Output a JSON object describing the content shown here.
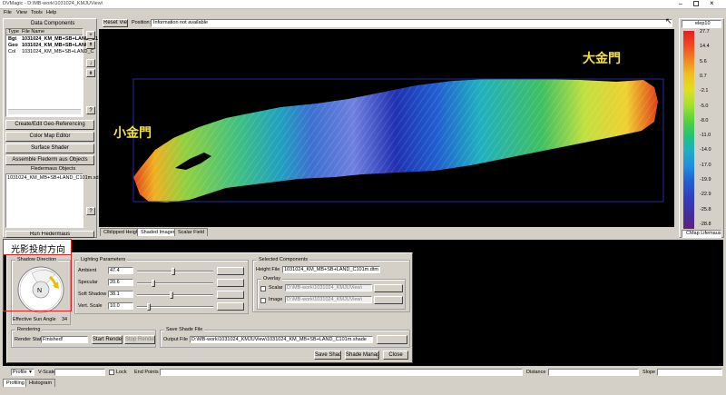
{
  "title_bar": {
    "title": "DVMagic - D:\\MB-work\\1031024_KMJUView\\"
  },
  "menu": [
    "File",
    "View",
    "Tools",
    "Help"
  ],
  "data_components": {
    "title": "Data Components",
    "col_type": "Type",
    "col_file": "File Name",
    "rows": [
      {
        "type": "Bgt",
        "file": "1031024_KM_MB+SB+LAND_C1",
        "bold": true
      },
      {
        "type": "Geo",
        "file": "1031024_KM_MB+SB+LAND_C",
        "bold": true
      },
      {
        "type": "Col",
        "file": "1031024_KM_MB+SB+LAND_C",
        "bold": false
      }
    ]
  },
  "side_buttons": [
    "Create/Edit Geo-Referencing",
    "Color Map Editor",
    "Surface Shader",
    "Assemble Flederm aus Objects"
  ],
  "fledermaus": {
    "title": "Fledermaus Objects",
    "item": "1031024_KM_MB+SB+LAND_C101m.sd"
  },
  "run_button": "Run Fledermaus",
  "viewer": {
    "reset": "Reset View",
    "position_label": "Position:",
    "position_value": "Information not available"
  },
  "map": {
    "label_big": "大金門",
    "label_small": "小金門"
  },
  "viewer_tabs": [
    "Clblipped Heights",
    "Shaded Imagery",
    "Scalar Field"
  ],
  "colorbar": {
    "header": "elep10",
    "ticks": [
      "27.7",
      "14.4",
      "5.6",
      "0.7",
      "-2.1",
      "-5.0",
      "-8.0",
      "-11.0",
      "-14.0",
      "-17.0",
      "-19.9",
      "-22.9",
      "-25.8",
      "-28.8"
    ],
    "footer": "CMap Lifemaus"
  },
  "help_btn": "?",
  "annotation": "光影投射方向",
  "shadow": {
    "group": "Shadow Direction",
    "effective_label": "Effective Sun Angle",
    "effective_value": "34"
  },
  "lighting": {
    "group": "Lighting Parameters",
    "params": [
      {
        "label": "Ambient",
        "value": "47.4",
        "level": 0.47
      },
      {
        "label": "Specular",
        "value": "20.6",
        "level": 0.2
      },
      {
        "label": "Soft Shadow",
        "value": "38.1",
        "level": 0.45
      },
      {
        "label": "Vert. Scale",
        "value": "10.0",
        "level": 0.14
      }
    ]
  },
  "selected": {
    "group": "Selected Components",
    "height_label": "Height File",
    "height_value": "1031024_KM_MB+SB+LAND_C101m.dtm",
    "overlay_group": "Overlay",
    "scalar_label": "Scalar",
    "scalar_value": "D:\\MB-work\\1031024_KMJUView\\",
    "image_label": "Image",
    "image_value": "D:\\MB-work\\1031024_KMJUView\\"
  },
  "rendering": {
    "group": "Rendering",
    "status_label": "Render Status",
    "status_value": "Finished!",
    "start": "Start Rendering",
    "stop": "Stop Rendering"
  },
  "save_file": {
    "group": "Save Shade File",
    "output_label": "Output File",
    "output_value": "D:\\MB-work\\1031024_KMJUView\\1031024_KM_MB+SB+LAND_C101m.shade"
  },
  "footer_buttons": [
    "Save Shade",
    "Shade Manager...",
    "Close"
  ],
  "bottom_bar": {
    "profile": "Profile",
    "vscale": "V-Scale",
    "lock": "Lock",
    "endpoints": "End Points",
    "distance": "Distance",
    "slope": "Slope"
  },
  "bottom_tabs": [
    "Profiling",
    "Histogram"
  ],
  "colors": {
    "annotation_red": "#e02020",
    "label_yellow": "#f0e040",
    "view_bg": "#000000"
  }
}
